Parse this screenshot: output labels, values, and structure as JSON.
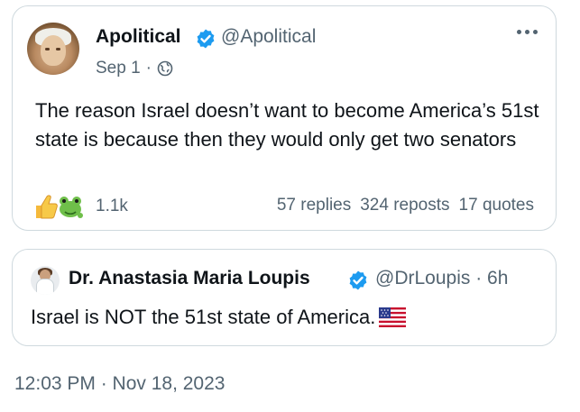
{
  "tweet": {
    "author_name": "Apolitical",
    "author_handle": "@Apolitical",
    "date": "Sep 1",
    "separator": "·",
    "globe_icon": "globe-icon",
    "text": "The reason Israel doesn’t want to become America’s 51st state is because then they would only get two senators",
    "reaction_count": "1.1k",
    "replies": "57 replies",
    "reposts": "324 reposts",
    "quotes": "17 quotes"
  },
  "quote": {
    "author_name": "Dr. Anastasia Maria Loupis",
    "author_handle": "@DrLoupis",
    "separator": "·",
    "time": "6h",
    "text": "Israel is NOT the 51st state of America."
  },
  "footer": {
    "timestamp": "12:03 PM · Nov 18, 2023"
  },
  "colors": {
    "verified": "#1d9bf0",
    "secondary_text": "#536471",
    "border": "#cfd9de"
  }
}
